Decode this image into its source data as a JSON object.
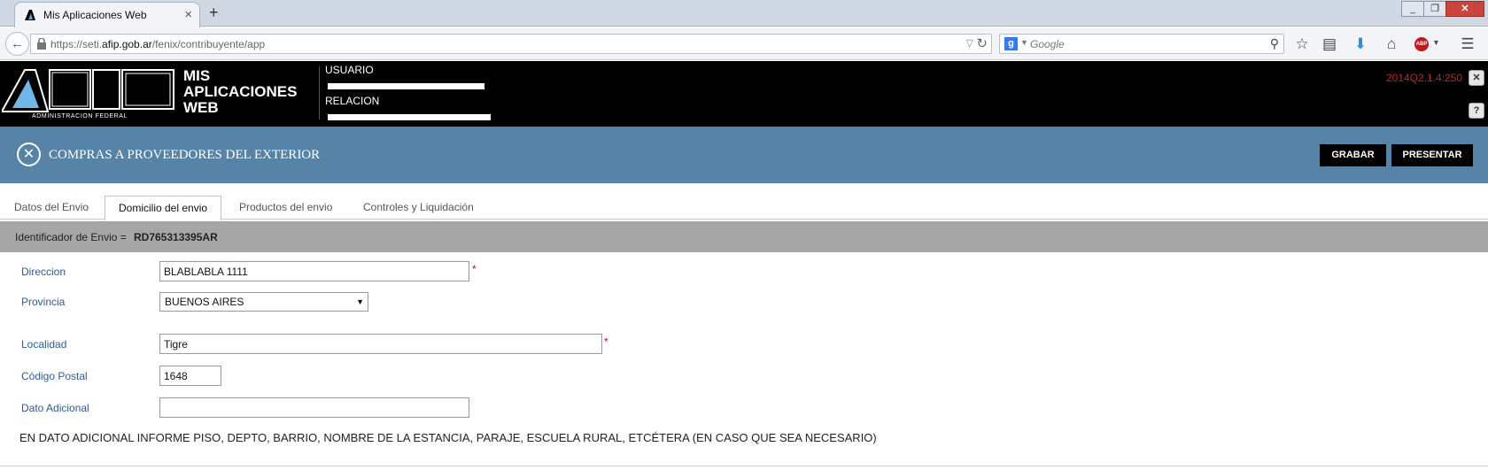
{
  "browser": {
    "tab_title": "Mis Aplicaciones Web",
    "url_prefix": "https://seti.",
    "url_domain": "afip.gob.ar",
    "url_path": "/fenix/contribuyente/app",
    "search_placeholder": "Google"
  },
  "header": {
    "app_title": [
      "MIS",
      "APLICACIONES",
      "WEB"
    ],
    "logo_subtext": "ADMINISTRACION FEDERAL",
    "usuario_label": "USUARIO",
    "relacion_label": "RELACION",
    "version": "2014Q2.1.4:250"
  },
  "page": {
    "title": "COMPRAS A PROVEEDORES DEL EXTERIOR",
    "grabar_label": "GRABAR",
    "presentar_label": "PRESENTAR"
  },
  "tabs": [
    {
      "label": "Datos del Envio",
      "active": false
    },
    {
      "label": "Domicilio del envio",
      "active": true
    },
    {
      "label": "Productos del envio",
      "active": false
    },
    {
      "label": "Controles y Liquidación",
      "active": false
    }
  ],
  "identifier": {
    "label": "Identificador de Envio =",
    "value": "RD765313395AR"
  },
  "form": {
    "direccion_label": "Direccion",
    "direccion_value": "BLABLABLA 1111",
    "provincia_label": "Provincia",
    "provincia_value": "BUENOS AIRES",
    "localidad_label": "Localidad",
    "localidad_value": "Tigre",
    "codigo_postal_label": "Código Postal",
    "codigo_postal_value": "1648",
    "dato_adicional_label": "Dato Adicional",
    "dato_adicional_value": "",
    "required_mark": "*",
    "note": "EN DATO ADICIONAL INFORME PISO, DEPTO, BARRIO, NOMBRE DE LA ESTANCIA, PARAJE, ESCUELA RURAL, ETCÉTERA (EN CASO QUE SEA NECESARIO)"
  },
  "colors": {
    "title_band": "#5683a8",
    "label_blue": "#2c5c9c",
    "version_red": "#b92828",
    "id_bar": "#a6a6a6"
  }
}
